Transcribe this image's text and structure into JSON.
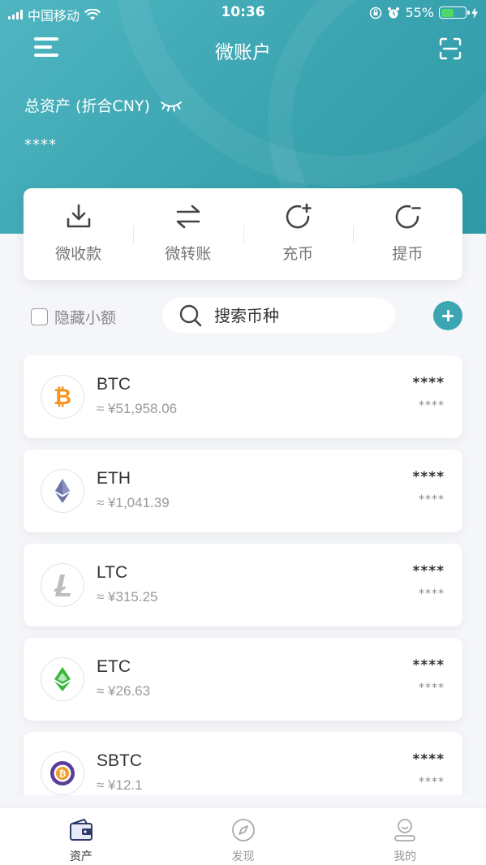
{
  "status_bar": {
    "carrier": "中国移动",
    "time": "10:36",
    "battery": "55%",
    "battery_fraction": 0.55
  },
  "header": {
    "title": "微账户",
    "total_label": "总资产 (折合CNY)",
    "total_value": "****"
  },
  "actions": [
    {
      "label": "微收款",
      "icon": "download-icon"
    },
    {
      "label": "微转账",
      "icon": "transfer-arrows-icon"
    },
    {
      "label": "充币",
      "icon": "deposit-refresh-plus-icon"
    },
    {
      "label": "提币",
      "icon": "withdraw-refresh-minus-icon"
    }
  ],
  "filter": {
    "hide_small_label": "隐藏小额",
    "search_placeholder": "搜索币种"
  },
  "coins": [
    {
      "symbol": "BTC",
      "price": "≈ ¥51,958.06",
      "balance": "****",
      "value": "****",
      "icon": "bitcoin-icon",
      "color": "#f7931a"
    },
    {
      "symbol": "ETH",
      "price": "≈ ¥1,041.39",
      "balance": "****",
      "value": "****",
      "icon": "ethereum-icon",
      "color": "#6b74a8"
    },
    {
      "symbol": "LTC",
      "price": "≈ ¥315.25",
      "balance": "****",
      "value": "****",
      "icon": "litecoin-icon",
      "color": "#bebebe"
    },
    {
      "symbol": "ETC",
      "price": "≈ ¥26.63",
      "balance": "****",
      "value": "****",
      "icon": "ethereum-classic-icon",
      "color": "#3ab83a"
    },
    {
      "symbol": "SBTC",
      "price": "≈ ¥12.1",
      "balance": "****",
      "value": "****",
      "icon": "super-bitcoin-icon",
      "color": "#5b3e9a"
    }
  ],
  "tabs": [
    {
      "label": "资产",
      "icon": "wallet-icon",
      "active": true
    },
    {
      "label": "发现",
      "icon": "compass-icon",
      "active": false
    },
    {
      "label": "我的",
      "icon": "profile-icon",
      "active": false
    }
  ],
  "colors": {
    "accent": "#3ba6b2",
    "header_bg": "#44adb9",
    "background": "#f5f6f9"
  }
}
